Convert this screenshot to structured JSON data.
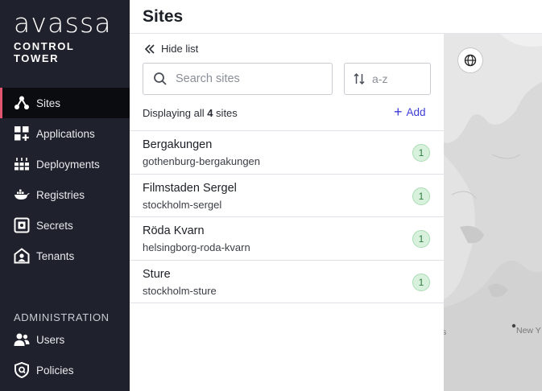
{
  "brand": {
    "wordmark": "avassa",
    "subtitle": "CONTROL TOWER"
  },
  "nav": {
    "items": [
      {
        "label": "Sites",
        "icon": "sites-icon",
        "active": true
      },
      {
        "label": "Applications",
        "icon": "applications-icon"
      },
      {
        "label": "Deployments",
        "icon": "deployments-icon"
      },
      {
        "label": "Registries",
        "icon": "registries-icon"
      },
      {
        "label": "Secrets",
        "icon": "secrets-icon"
      },
      {
        "label": "Tenants",
        "icon": "tenants-icon"
      }
    ],
    "admin_heading": "ADMINISTRATION",
    "admin_items": [
      {
        "label": "Users",
        "icon": "users-icon"
      },
      {
        "label": "Policies",
        "icon": "policies-icon"
      }
    ]
  },
  "header": {
    "title": "Sites"
  },
  "panel": {
    "hide_list": "Hide list",
    "search_placeholder": "Search sites",
    "sort_placeholder": "a-z",
    "displaying_prefix": "Displaying all ",
    "displaying_count": "4",
    "displaying_suffix": " sites",
    "add_label": "Add",
    "sites": [
      {
        "name": "Bergakungen",
        "id": "gothenburg-bergakungen",
        "count": "1"
      },
      {
        "name": "Filmstaden Sergel",
        "id": "stockholm-sergel",
        "count": "1"
      },
      {
        "name": "Röda Kvarn",
        "id": "helsingborg-roda-kvarn",
        "count": "1"
      },
      {
        "name": "Sture",
        "id": "stockholm-sture",
        "count": "1"
      }
    ]
  },
  "map": {
    "labels": [
      "s",
      "New Y"
    ]
  },
  "colors": {
    "sidebar": "#1f222c",
    "accent": "#e0566e",
    "link": "#3c3bd6",
    "badge": "#d7f1dc"
  }
}
